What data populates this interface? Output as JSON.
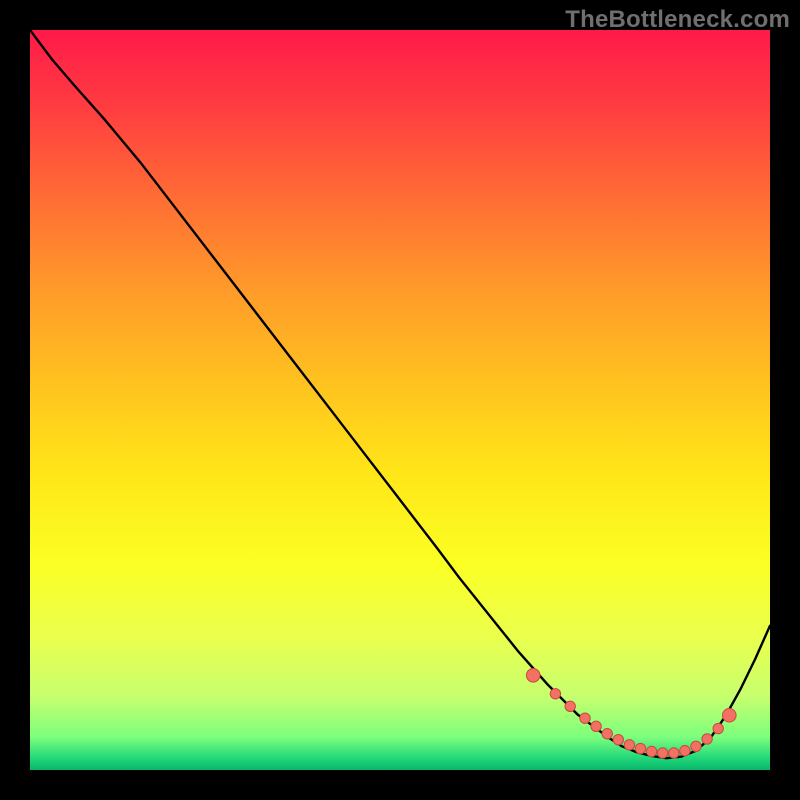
{
  "watermark": "TheBottleneck.com",
  "colors": {
    "bg": "#000000",
    "curve": "#000000",
    "marker_fill": "#f37164",
    "marker_stroke": "#c94a3e",
    "grad_stops": [
      {
        "off": 0.0,
        "c": "#ff1a49"
      },
      {
        "off": 0.1,
        "c": "#ff3b41"
      },
      {
        "off": 0.22,
        "c": "#ff6a35"
      },
      {
        "off": 0.35,
        "c": "#ff9a2a"
      },
      {
        "off": 0.48,
        "c": "#ffc31f"
      },
      {
        "off": 0.6,
        "c": "#ffe618"
      },
      {
        "off": 0.72,
        "c": "#fbff23"
      },
      {
        "off": 0.82,
        "c": "#eaff4d"
      },
      {
        "off": 0.9,
        "c": "#c7ff6e"
      },
      {
        "off": 0.955,
        "c": "#7dff7d"
      },
      {
        "off": 0.985,
        "c": "#1fd67a"
      },
      {
        "off": 1.0,
        "c": "#0ab56a"
      }
    ]
  },
  "chart_data": {
    "type": "line",
    "title": "",
    "xlabel": "",
    "ylabel": "",
    "xlim": [
      0,
      100
    ],
    "ylim": [
      0,
      100
    ],
    "grid": false,
    "legend": false,
    "series": [
      {
        "name": "bottleneck-curve",
        "x": [
          0,
          3,
          6,
          10,
          15,
          20,
          25,
          30,
          35,
          40,
          45,
          50,
          55,
          58,
          62,
          66,
          70,
          74,
          78,
          80,
          82,
          84,
          86,
          88,
          90,
          92,
          94,
          96,
          98,
          100
        ],
        "y": [
          100,
          96,
          92.5,
          88,
          82,
          75.5,
          69,
          62.5,
          56,
          49.5,
          43,
          36.5,
          30,
          26,
          21,
          16,
          11.5,
          7.5,
          4.5,
          3.2,
          2.4,
          1.9,
          1.6,
          1.8,
          2.6,
          4.4,
          7.3,
          10.9,
          15.0,
          19.5
        ]
      }
    ],
    "markers": {
      "name": "highlight-points",
      "x": [
        68,
        71,
        73,
        75,
        76.5,
        78,
        79.5,
        81,
        82.5,
        84,
        85.5,
        87,
        88.5,
        90,
        91.5,
        93,
        94.5
      ],
      "y": [
        12.8,
        10.3,
        8.6,
        7.0,
        5.9,
        4.9,
        4.1,
        3.4,
        2.9,
        2.5,
        2.3,
        2.3,
        2.6,
        3.2,
        4.2,
        5.6,
        7.4
      ]
    }
  }
}
